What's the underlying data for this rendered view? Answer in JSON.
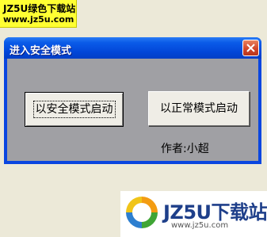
{
  "watermark_top": {
    "line1": "JZ5U绿色下载站",
    "line2": "www.jz5u.com"
  },
  "window": {
    "title": "进入安全模式",
    "close_label": "×"
  },
  "buttons": {
    "safe_mode": "以安全模式启动",
    "normal_mode": "以正常模式启动"
  },
  "author_label": "作者:小超",
  "watermark_bottom": {
    "brand": "JZ5U下载站",
    "url": "www.jz5u.com"
  },
  "colors": {
    "titlebar": "#0a5be8",
    "client": "#a0a0a4",
    "close_button": "#d2462a",
    "desktop": "#ece9d8"
  }
}
